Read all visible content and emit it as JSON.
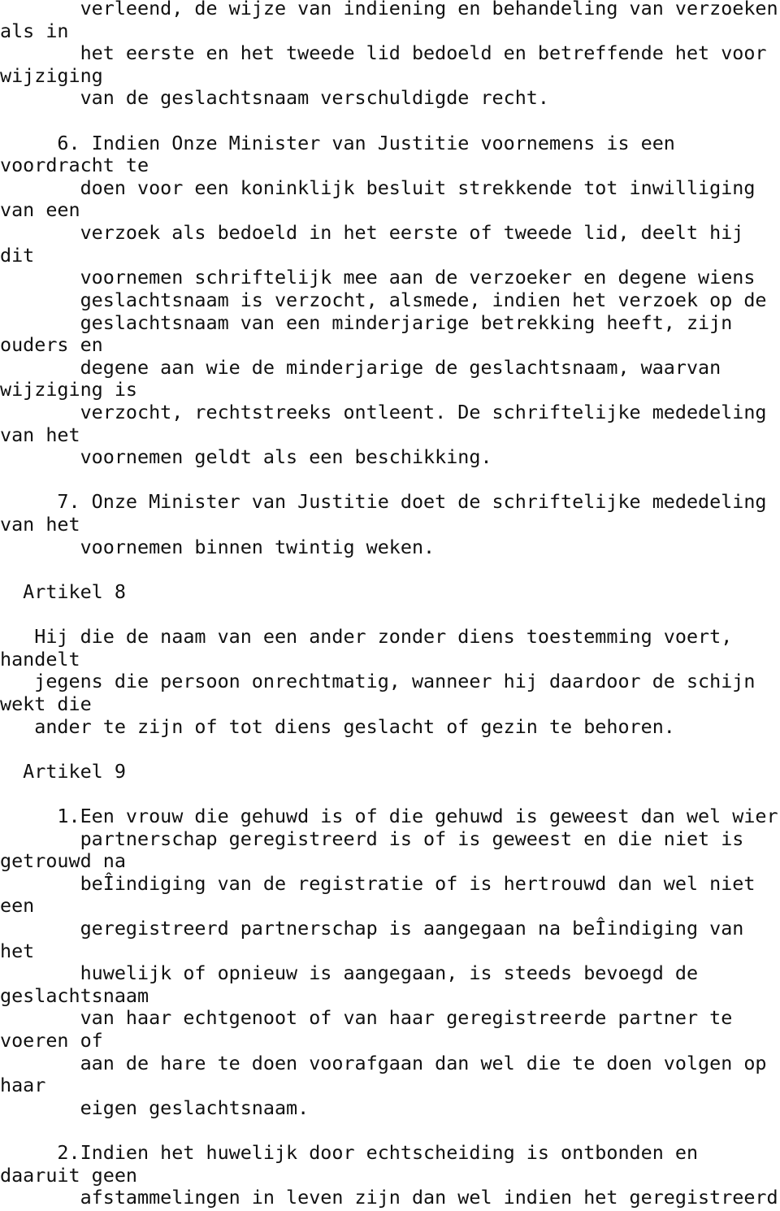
{
  "document": {
    "lines": [
      "       verleend, de wijze van indiening en behandeling van verzoeken",
      "als in",
      "       het eerste en het tweede lid bedoeld en betreffende het voor",
      "wijziging",
      "       van de geslachtsnaam verschuldigde recht.",
      "",
      "     6. Indien Onze Minister van Justitie voornemens is een",
      "voordracht te",
      "       doen voor een koninklijk besluit strekkende tot inwilliging",
      "van een",
      "       verzoek als bedoeld in het eerste of tweede lid, deelt hij",
      "dit",
      "       voornemen schriftelijk mee aan de verzoeker en degene wiens",
      "       geslachtsnaam is verzocht, alsmede, indien het verzoek op de",
      "       geslachtsnaam van een minderjarige betrekking heeft, zijn",
      "ouders en",
      "       degene aan wie de minderjarige de geslachtsnaam, waarvan",
      "wijziging is",
      "       verzocht, rechtstreeks ontleent. De schriftelijke mededeling",
      "van het",
      "       voornemen geldt als een beschikking.",
      "",
      "     7. Onze Minister van Justitie doet de schriftelijke mededeling",
      "van het",
      "       voornemen binnen twintig weken.",
      "",
      "  Artikel 8",
      "",
      "   Hij die de naam van een ander zonder diens toestemming voert,",
      "handelt",
      "   jegens die persoon onrechtmatig, wanneer hij daardoor de schijn",
      "wekt die",
      "   ander te zijn of tot diens geslacht of gezin te behoren.",
      "",
      "  Artikel 9",
      "",
      "     1.Een vrouw die gehuwd is of die gehuwd is geweest dan wel wier",
      "       partnerschap geregistreerd is of is geweest en die niet is",
      "getrouwd na",
      "       beÎindiging van de registratie of is hertrouwd dan wel niet",
      "een",
      "       geregistreerd partnerschap is aangegaan na beÎindiging van",
      "het",
      "       huwelijk of opnieuw is aangegaan, is steeds bevoegd de",
      "geslachtsnaam",
      "       van haar echtgenoot of van haar geregistreerde partner te",
      "voeren of",
      "       aan de hare te doen voorafgaan dan wel die te doen volgen op",
      "haar",
      "       eigen geslachtsnaam.",
      "",
      "     2.Indien het huwelijk door echtscheiding is ontbonden en",
      "daaruit geen",
      "       afstammelingen in leven zijn dan wel indien het geregistreerd"
    ]
  }
}
